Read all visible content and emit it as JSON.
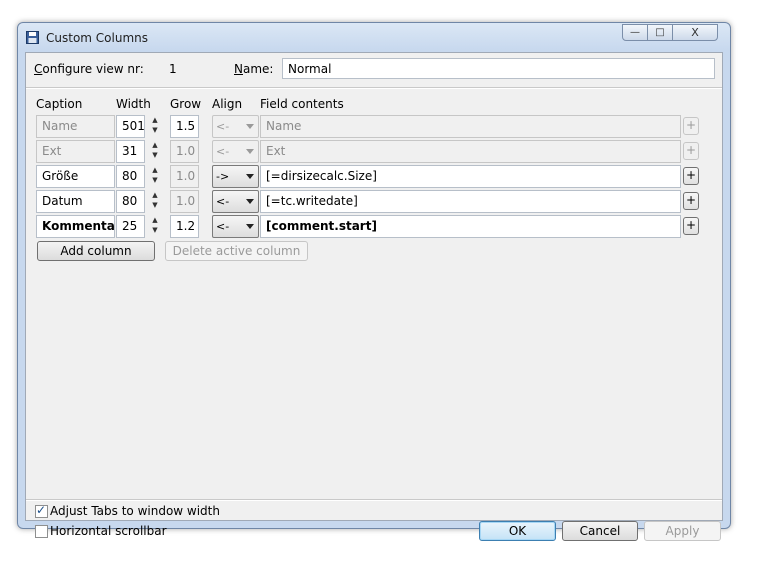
{
  "window": {
    "title": "Custom Columns",
    "minimize": "—",
    "maximize": "□",
    "close": "X"
  },
  "top": {
    "view_label": "Configure view nr:",
    "view_label_accel": "C",
    "view_label_rest": "onfigure view nr:",
    "view_nr": "1",
    "name_label_accel": "N",
    "name_label_rest": "ame:",
    "name_value": "Normal"
  },
  "headers": {
    "caption": "Caption",
    "width": "Width",
    "grow": "Grow",
    "align": "Align",
    "field": "Field contents"
  },
  "rows": [
    {
      "caption": "Name",
      "width": "501",
      "grow": "1.5",
      "align": "<-",
      "field": "Name",
      "plus": "+"
    },
    {
      "caption": "Ext",
      "width": "31",
      "grow": "1.0",
      "align": "<-",
      "field": "Ext",
      "plus": "+"
    },
    {
      "caption": "Größe",
      "width": "80",
      "grow": "1.0",
      "align": "->",
      "field": "[=dirsizecalc.Size]",
      "plus": "+"
    },
    {
      "caption": "Datum",
      "width": "80",
      "grow": "1.0",
      "align": "<-",
      "field": "[=tc.writedate]",
      "plus": "+"
    },
    {
      "caption": "Kommentar",
      "width": "25",
      "grow": "1.2",
      "align": "<-",
      "field": "[comment.start]",
      "plus": "+"
    }
  ],
  "buttons": {
    "add_column": "Add column",
    "delete_column": "Delete active column",
    "ok": "OK",
    "cancel": "Cancel",
    "apply": "Apply"
  },
  "options": {
    "adjust_tabs": {
      "label": "Adjust Tabs to window width",
      "checked": true
    },
    "horizontal_scrollbar": {
      "label": "Horizontal scrollbar",
      "checked": false
    }
  },
  "spinner": {
    "up": "▲",
    "down": "▼"
  }
}
